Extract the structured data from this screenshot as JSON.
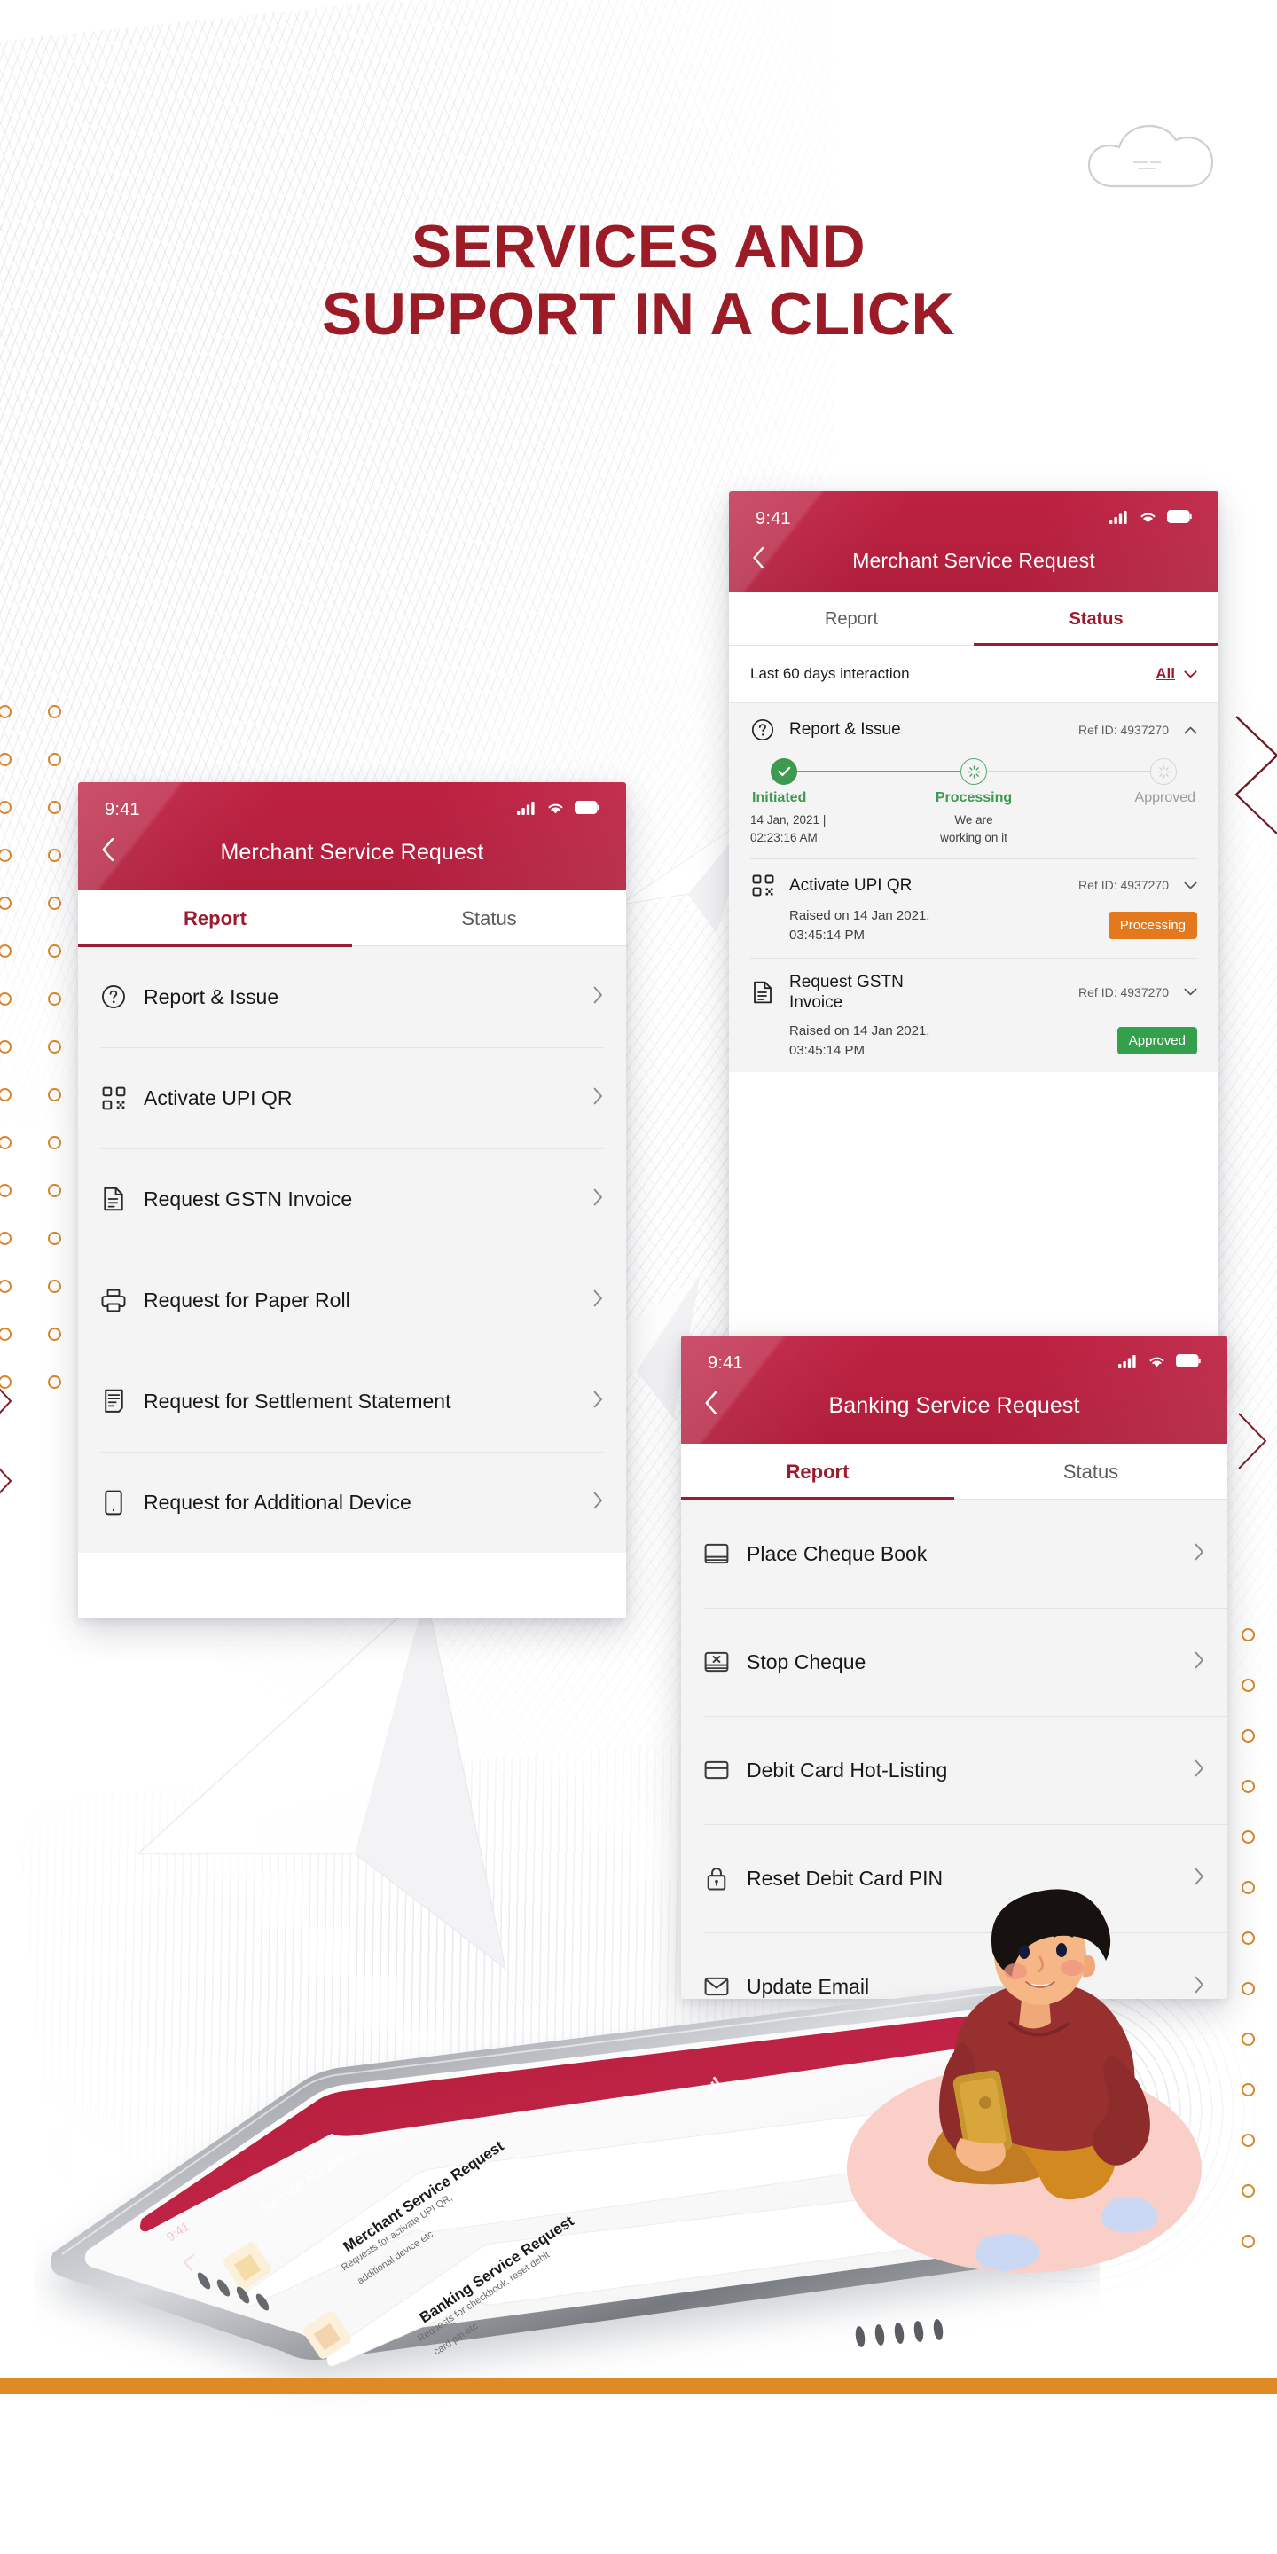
{
  "hero": {
    "line1": "SERVICES AND",
    "line2": "SUPPORT IN A CLICK",
    "color": "#9B1C26"
  },
  "theme": {
    "brand_red": "#BE2142",
    "brand_dark_red": "#9B1C2E",
    "accent_orange": "#DE8B26",
    "status_processing": "#E3781D",
    "status_approved": "#35A04B",
    "tracker_green": "#3D9A4E"
  },
  "status_bar": {
    "time": "9:41",
    "icons": [
      "signal-icon",
      "wifi-icon",
      "battery-icon"
    ]
  },
  "phone_merchant_report": {
    "title": "Merchant Service Request",
    "back_icon": "chevron-left-icon",
    "tabs": [
      {
        "label": "Report",
        "active": true
      },
      {
        "label": "Status",
        "active": false
      }
    ],
    "items": [
      {
        "label": "Report & Issue",
        "icon": "question-circle-icon"
      },
      {
        "label": "Activate UPI QR",
        "icon": "qr-code-icon"
      },
      {
        "label": "Request GSTN Invoice",
        "icon": "document-icon"
      },
      {
        "label": "Request for Paper Roll",
        "icon": "printer-icon"
      },
      {
        "label": "Request for Settlement Statement",
        "icon": "receipt-icon"
      },
      {
        "label": "Request for Additional Device",
        "icon": "mobile-device-icon"
      }
    ],
    "row_chevron": "chevron-right-icon"
  },
  "phone_merchant_status": {
    "title": "Merchant Service Request",
    "back_icon": "chevron-left-icon",
    "tabs": [
      {
        "label": "Report",
        "active": false
      },
      {
        "label": "Status",
        "active": true
      }
    ],
    "filter": {
      "label": "Last 60 days interaction",
      "value": "All",
      "caret_icon": "chevron-down-icon"
    },
    "entries": [
      {
        "name": "Report & Issue",
        "icon": "question-circle-icon",
        "ref": "Ref ID: 4937270",
        "caret_icon": "chevron-up-icon",
        "expanded": true,
        "tracker": {
          "steps": [
            "Initiated",
            "Processing",
            "Approved"
          ],
          "states": [
            "done",
            "active",
            "idle"
          ],
          "sub": [
            "14 Jan, 2021 | 02:23:16 AM",
            "We are working on it",
            ""
          ],
          "sub_line1": [
            "14 Jan, 2021 |",
            "We are",
            ""
          ],
          "sub_line2": [
            "02:23:16 AM",
            "working on it",
            ""
          ]
        }
      },
      {
        "name": "Activate UPI QR",
        "icon": "qr-code-icon",
        "ref": "Ref ID: 4937270",
        "caret_icon": "chevron-down-icon",
        "expanded": false,
        "raised_line1": "Raised on 14 Jan 2021,",
        "raised_line2": "03:45:14 PM",
        "chip": "Processing",
        "chip_type": "processing"
      },
      {
        "name": "Request GSTN Invoice",
        "name_line1": "Request GSTN",
        "name_line2": "Invoice",
        "icon": "document-icon",
        "ref": "Ref ID: 4937270",
        "caret_icon": "chevron-down-icon",
        "expanded": false,
        "raised_line1": "Raised on 14 Jan 2021,",
        "raised_line2": "03:45:14 PM",
        "chip": "Approved",
        "chip_type": "approved"
      }
    ]
  },
  "phone_banking": {
    "title": "Banking Service Request",
    "back_icon": "chevron-left-icon",
    "tabs": [
      {
        "label": "Report",
        "active": true
      },
      {
        "label": "Status",
        "active": false
      }
    ],
    "items": [
      {
        "label": "Place Cheque Book",
        "icon": "cheque-book-icon"
      },
      {
        "label": "Stop Cheque",
        "icon": "stop-cheque-icon"
      },
      {
        "label": "Debit Card Hot-Listing",
        "icon": "credit-card-icon"
      },
      {
        "label": "Reset Debit Card PIN",
        "icon": "lock-icon"
      },
      {
        "label": "Update Email",
        "icon": "envelope-icon"
      }
    ],
    "row_chevron": "chevron-right-icon"
  },
  "device_hero": {
    "status_time": "9:41",
    "title": "Service Request",
    "back_icon": "chevron-left-icon",
    "cards": [
      {
        "title": "Merchant Service Request",
        "subtitle": "Requests for activate UPI QR, additional device etc",
        "chevron": "chevron-right-icon"
      },
      {
        "title": "Banking Service Request",
        "subtitle": "Requests for checkbook, reset debit card pin etc",
        "chevron": "chevron-right-icon"
      }
    ]
  },
  "decorations": {
    "cloud_icon": "cloud-outline-icon",
    "left_dots_icon": "ring-dot-icon",
    "right_dots_icon": "ring-dot-icon",
    "chevron_mark_icon": "double-chevron-outline-icon",
    "person_icon": "person-with-phone-illustration"
  }
}
